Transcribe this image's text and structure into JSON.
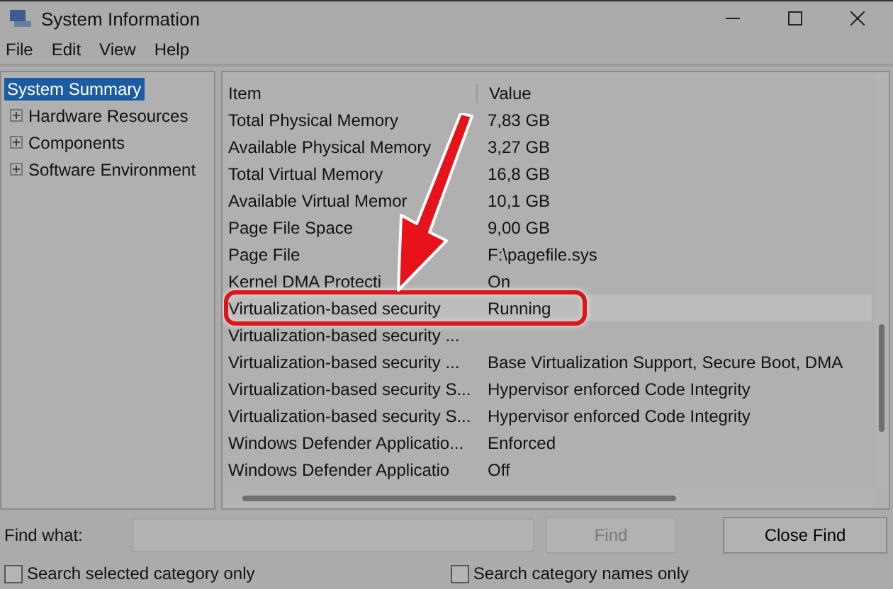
{
  "window": {
    "title": "System Information"
  },
  "menu": [
    "File",
    "Edit",
    "View",
    "Help"
  ],
  "tree": [
    {
      "label": "System Summary",
      "selected": true,
      "expandable": false
    },
    {
      "label": "Hardware Resources",
      "selected": false,
      "expandable": true
    },
    {
      "label": "Components",
      "selected": false,
      "expandable": true
    },
    {
      "label": "Software Environment",
      "selected": false,
      "expandable": true
    }
  ],
  "table": {
    "columns": [
      "Item",
      "Value"
    ],
    "rows": [
      {
        "item": "Total Physical Memory",
        "value": "7,83 GB",
        "selected": false,
        "annotated": false
      },
      {
        "item": "Available Physical Memory",
        "value": "3,27 GB",
        "selected": false,
        "annotated": false
      },
      {
        "item": "Total Virtual Memory",
        "value": "16,8 GB",
        "selected": false,
        "annotated": false
      },
      {
        "item": "Available Virtual Memor",
        "value": "10,1 GB",
        "selected": false,
        "annotated": false
      },
      {
        "item": "Page File Space",
        "value": "9,00 GB",
        "selected": false,
        "annotated": false
      },
      {
        "item": "Page File",
        "value": "F:\\pagefile.sys",
        "selected": false,
        "annotated": false
      },
      {
        "item": "Kernel DMA Protecti",
        "value": "On",
        "selected": false,
        "annotated": false
      },
      {
        "item": "Virtualization-based security",
        "value": "Running",
        "selected": true,
        "annotated": true
      },
      {
        "item": "Virtualization-based security ...",
        "value": "",
        "selected": false,
        "annotated": false
      },
      {
        "item": "Virtualization-based security ...",
        "value": "Base Virtualization Support, Secure Boot, DMA",
        "selected": false,
        "annotated": false
      },
      {
        "item": "Virtualization-based security S...",
        "value": "Hypervisor enforced Code Integrity",
        "selected": false,
        "annotated": false
      },
      {
        "item": "Virtualization-based security S...",
        "value": "Hypervisor enforced Code Integrity",
        "selected": false,
        "annotated": false
      },
      {
        "item": "Windows Defender Applicatio...",
        "value": "Enforced",
        "selected": false,
        "annotated": false
      },
      {
        "item": "Windows Defender Applicatio",
        "value": "Off",
        "selected": false,
        "annotated": false
      }
    ]
  },
  "find": {
    "label": "Find what:",
    "find_button": {
      "label": "Find",
      "disabled": true
    },
    "close_button": "Close Find",
    "options": [
      {
        "label": "Search selected category only",
        "checked": false
      },
      {
        "label": "Search category names only",
        "checked": false
      }
    ]
  }
}
